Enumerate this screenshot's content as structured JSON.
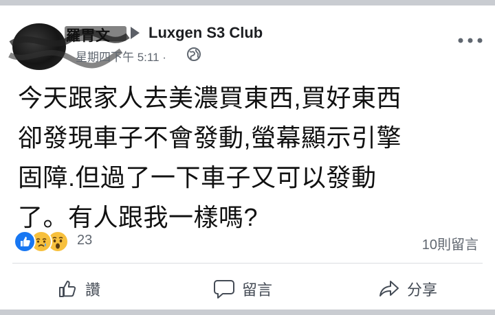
{
  "post": {
    "author_name": "羅胃文",
    "group_name": "Luxgen S3 Club",
    "timestamp": "星期四下午 5:11 ·",
    "body_lines": [
      "今天跟家人去美濃買東西,買好東西",
      "卻發現車子不會發動,螢幕顯示引擎",
      "固障.但過了一下車子又可以發動",
      "了。有人跟我一樣嗎?"
    ]
  },
  "engagement": {
    "reaction_count": "23",
    "comment_count": "10則留言",
    "reactions": [
      "like",
      "sad",
      "wow"
    ]
  },
  "actions": {
    "like_label": "讚",
    "comment_label": "留言",
    "share_label": "分享"
  },
  "icons": {
    "audience": "globe-icon",
    "menu": "more-options-icon",
    "like": "thumbs-up-icon",
    "comment": "speech-bubble-icon",
    "share": "share-arrow-icon"
  },
  "colors": {
    "like_blue": "#1877f2",
    "emoji_yellow": "#f7c03d",
    "secondary_text": "#606770"
  }
}
